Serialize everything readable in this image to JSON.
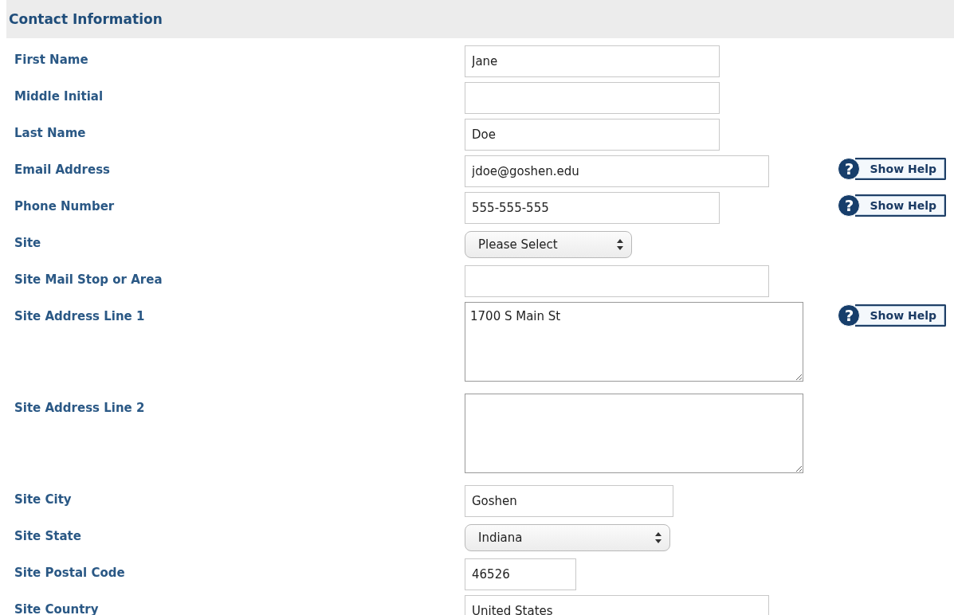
{
  "section": {
    "title": "Contact Information"
  },
  "fields": [
    {
      "label": "First Name",
      "kind": "text",
      "value": "Jane"
    },
    {
      "label": "Middle Initial",
      "kind": "text"
    },
    {
      "label": "Last Name",
      "kind": "text",
      "value": "Doe"
    },
    {
      "label": "Email Address",
      "kind": "text",
      "value": "jdoe@goshen.edu",
      "help": {
        "icon": "?",
        "label": "Show Help"
      }
    },
    {
      "label": "Phone Number",
      "kind": "text",
      "value": "555-555-555",
      "help": {
        "icon": "?",
        "label": "Show Help"
      }
    },
    {
      "label": "Site",
      "kind": "select",
      "value": "Please Select"
    },
    {
      "label": "Site Mail Stop or Area",
      "kind": "text"
    },
    {
      "label": "Site Address Line 1",
      "kind": "textarea",
      "value": "1700 S Main St",
      "help": {
        "icon": "?",
        "label": "Show Help"
      }
    },
    {
      "label": "Site Address Line 2",
      "kind": "textarea"
    },
    {
      "label": "Site City",
      "kind": "text",
      "value": "Goshen"
    },
    {
      "label": "Site State",
      "kind": "select",
      "value": "Indiana"
    },
    {
      "label": "Site Postal Code",
      "kind": "text",
      "value": "46526"
    },
    {
      "label": "Site Country",
      "kind": "text",
      "value": "United States"
    }
  ]
}
